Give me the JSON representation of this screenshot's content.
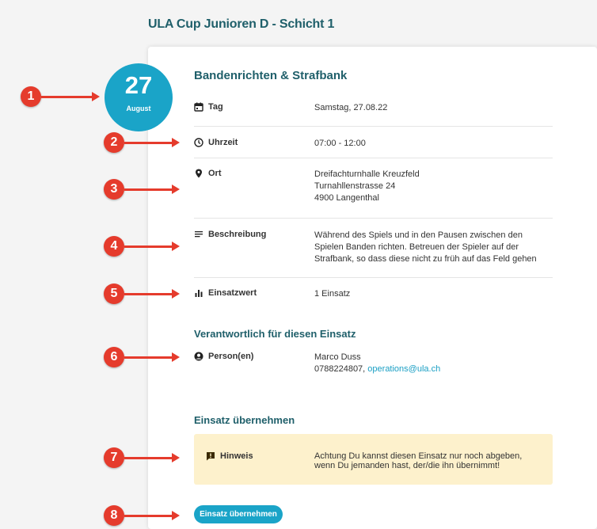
{
  "page_title": "ULA Cup Junioren D - Schicht 1",
  "date": {
    "day": "27",
    "month": "August"
  },
  "shift_title": "Bandenrichten & Strafbank",
  "details": {
    "tag": {
      "label": "Tag",
      "value": "Samstag, 27.08.22"
    },
    "uhrzeit": {
      "label": "Uhrzeit",
      "value": "07:00 - 12:00"
    },
    "ort": {
      "label": "Ort",
      "line1": "Dreifachturnhalle Kreuzfeld",
      "line2": "Turnahllenstrasse 24",
      "line3": "4900 Langenthal"
    },
    "beschreibung": {
      "label": "Beschreibung",
      "value": "Während des Spiels und in den Pausen zwischen den Spielen Banden richten. Betreuen der Spieler auf der Strafbank, so dass diese nicht zu früh auf das Feld gehen"
    },
    "einsatzwert": {
      "label": "Einsatzwert",
      "value": "1 Einsatz"
    }
  },
  "responsible": {
    "heading": "Verantwortlich für diesen Einsatz",
    "label": "Person(en)",
    "name": "Marco Duss",
    "phone": "0788224807,",
    "email": "operations@ula.ch"
  },
  "take_over": {
    "heading": "Einsatz übernehmen",
    "hint_label": "Hinweis",
    "hint_text": "Achtung Du kannst diesen Einsatz nur noch abgeben, wenn Du jemanden hast, der/die ihn übernimmt!",
    "button_label": "Einsatz übernehmen"
  },
  "markers": [
    "1",
    "2",
    "3",
    "4",
    "5",
    "6",
    "7",
    "8"
  ],
  "colors": {
    "accent": "#1aa4c8",
    "title": "#1f5f6a",
    "marker": "#e53b2c",
    "hint_bg": "#fdf1cc"
  }
}
